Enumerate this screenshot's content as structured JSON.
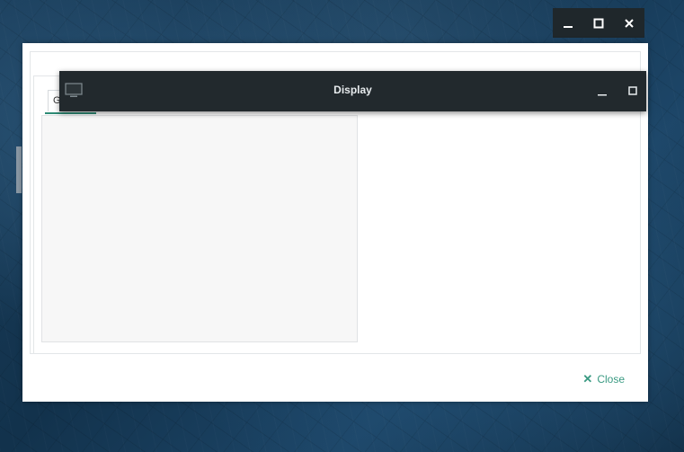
{
  "colors": {
    "accent": "#3a9a82",
    "tab_underline": "#2e8b75",
    "titlebar": "#22292d",
    "parent_titlebar": "#1f272b"
  },
  "parent_window": {
    "controls": [
      "minimize-icon",
      "maximize-icon",
      "close-icon"
    ]
  },
  "dialog": {
    "tab_label": "G",
    "close_label": "Close",
    "close_icon": "close-x-icon"
  },
  "display_window": {
    "title": "Display",
    "icon": "monitor-icon",
    "controls": [
      "minimize-icon",
      "maximize-icon"
    ]
  }
}
